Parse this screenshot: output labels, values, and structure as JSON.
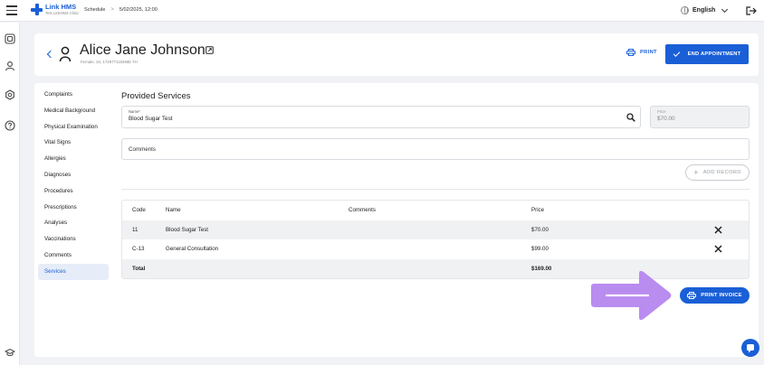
{
  "app": {
    "name": "Link HMS",
    "subtitle": "Test LinkHMS Clinic"
  },
  "breadcrumb": {
    "schedule": "Schedule",
    "separator": ">",
    "datetime": "5/02/2025, 12:00"
  },
  "language": "English",
  "patient": {
    "name": "Alice Jane Johnson",
    "details": "Female, 34, 172977115368b TH"
  },
  "header_actions": {
    "print": "PRINT",
    "end": "END APPOINTMENT"
  },
  "nav": {
    "items": [
      "Complaints",
      "Medical Background",
      "Physical Examination",
      "Vital Signs",
      "Allergies",
      "Diagnoses",
      "Procedures",
      "Prescriptions",
      "Analyses",
      "Vaccinations",
      "Comments",
      "Services"
    ],
    "active": "Services"
  },
  "services": {
    "title": "Provided Services",
    "name_label": "Name*",
    "name_value": "Blood Sugar Test",
    "price_label": "Price",
    "price_value": "$70.00",
    "comments_label": "Comments",
    "add_record": "ADD RECORD"
  },
  "table": {
    "headers": [
      "Code",
      "Name",
      "Comments",
      "Price"
    ],
    "rows": [
      {
        "code": "11",
        "name": "Blood Sugar Test",
        "comments": "",
        "price": "$70.00"
      },
      {
        "code": "C-13",
        "name": "General Consultation",
        "comments": "",
        "price": "$99.00"
      }
    ],
    "total_label": "Total",
    "total_value": "$169.00"
  },
  "print_invoice": "PRINT INVOICE",
  "colors": {
    "primary": "#1a5fd6",
    "arrow": "#b98cf0",
    "background": "#f1f2f5"
  },
  "icons": [
    "menu-icon",
    "globe-icon",
    "chevron-down-icon",
    "logout-icon",
    "calendar-icon",
    "user-icon",
    "settings-icon",
    "help-icon",
    "graduation-icon",
    "back-icon",
    "person-icon",
    "external-link-icon",
    "printer-icon",
    "check-icon",
    "search-icon",
    "plus-icon",
    "close-icon",
    "chat-icon"
  ]
}
